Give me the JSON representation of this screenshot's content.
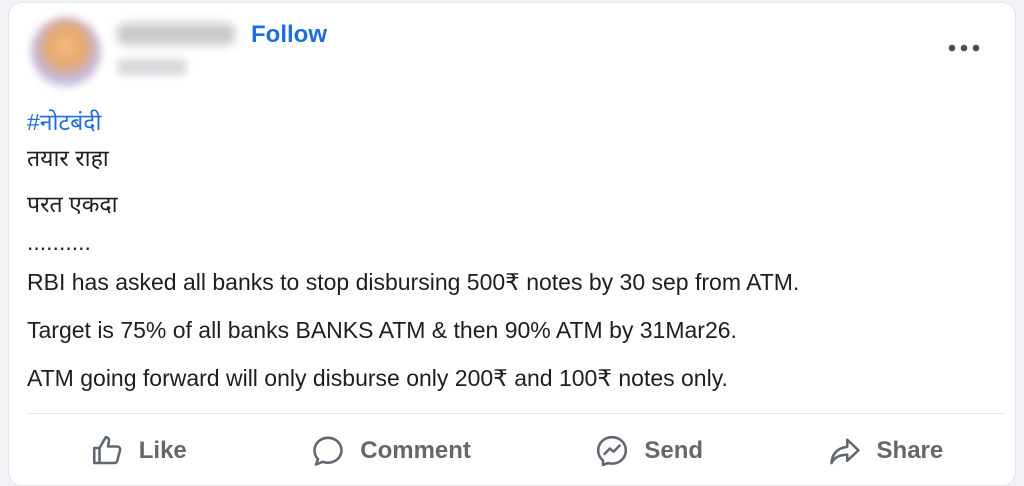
{
  "post": {
    "follow_label": "Follow",
    "hashtag": "#नोटबंदी",
    "lines": [
      "तयार राहा",
      "परत एकदा",
      "..........",
      "RBI has asked all  banks to stop disbursing 500₹ notes by 30 sep from ATM.",
      "Target is 75% of all banks BANKS ATM & then 90% ATM by 31Mar26.",
      "ATM going forward will only disburse only 200₹ and 100₹ notes only."
    ]
  },
  "actions": {
    "like": "Like",
    "comment": "Comment",
    "send": "Send",
    "share": "Share"
  },
  "icons": {
    "more": "more-options-icon",
    "like": "thumbs-up-icon",
    "comment": "comment-bubble-icon",
    "send": "messenger-icon",
    "share": "share-arrow-icon"
  },
  "colors": {
    "link": "#1e6ed9",
    "text": "#1c1e21",
    "secondary": "#65676b"
  }
}
